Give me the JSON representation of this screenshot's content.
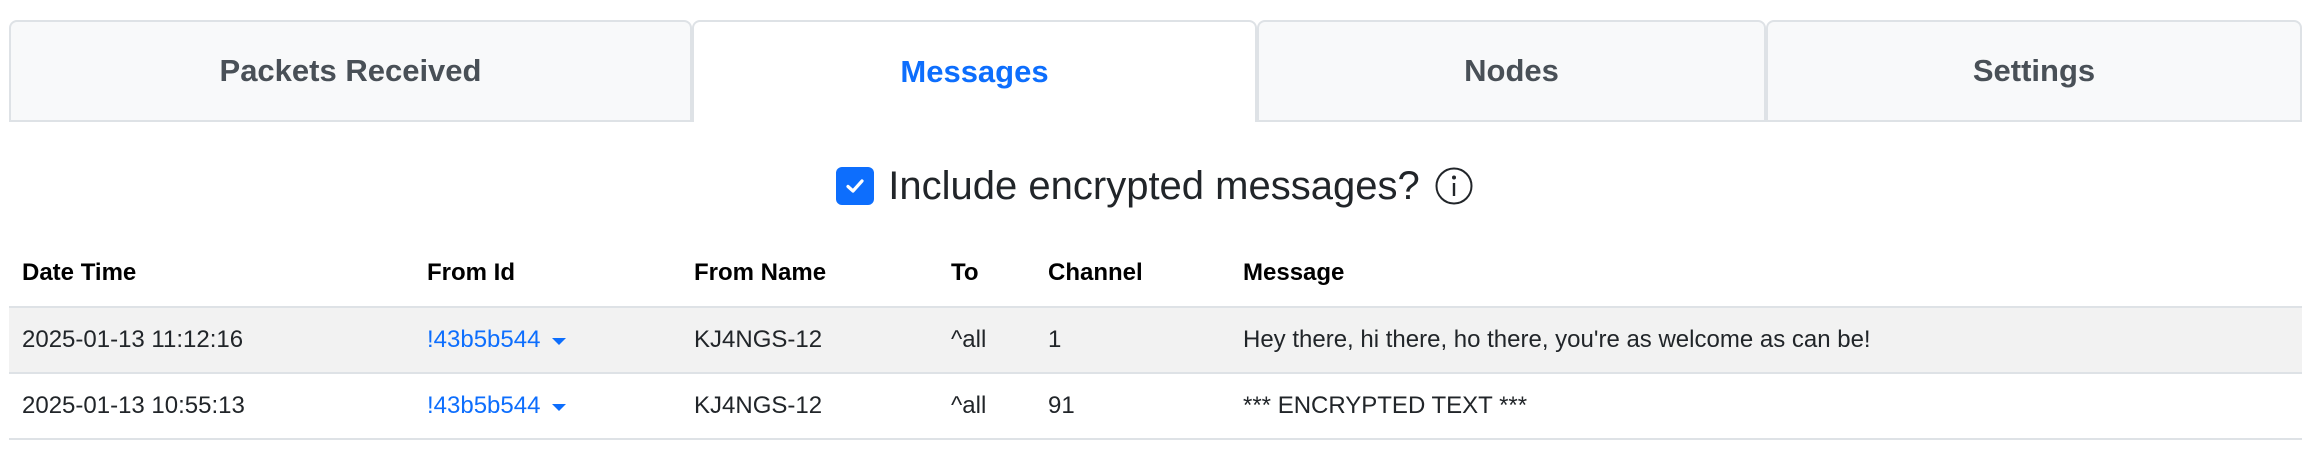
{
  "tabs": [
    {
      "label": "Packets Received",
      "active": false
    },
    {
      "label": "Messages",
      "active": true
    },
    {
      "label": "Nodes",
      "active": false
    },
    {
      "label": "Settings",
      "active": false
    }
  ],
  "filter": {
    "include_encrypted_label": "Include encrypted messages?",
    "include_encrypted_checked": true
  },
  "table": {
    "headers": {
      "date_time": "Date Time",
      "from_id": "From Id",
      "from_name": "From Name",
      "to": "To",
      "channel": "Channel",
      "message": "Message"
    },
    "rows": [
      {
        "date_time": "2025-01-13 11:12:16",
        "from_id": "!43b5b544",
        "from_name": "KJ4NGS-12",
        "to": "^all",
        "channel": "1",
        "message": "Hey there, hi there, ho there, you're as welcome as can be!"
      },
      {
        "date_time": "2025-01-13 10:55:13",
        "from_id": "!43b5b544",
        "from_name": "KJ4NGS-12",
        "to": "^all",
        "channel": "91",
        "message": "*** ENCRYPTED TEXT ***"
      }
    ]
  },
  "colors": {
    "accent": "#0d6efd",
    "tab_inactive_text": "#495057",
    "row_striped": "#f2f2f2"
  },
  "icons": {
    "checkbox": "checkmark-icon",
    "info": "info-circle-icon",
    "dropdown": "caret-down-icon"
  }
}
